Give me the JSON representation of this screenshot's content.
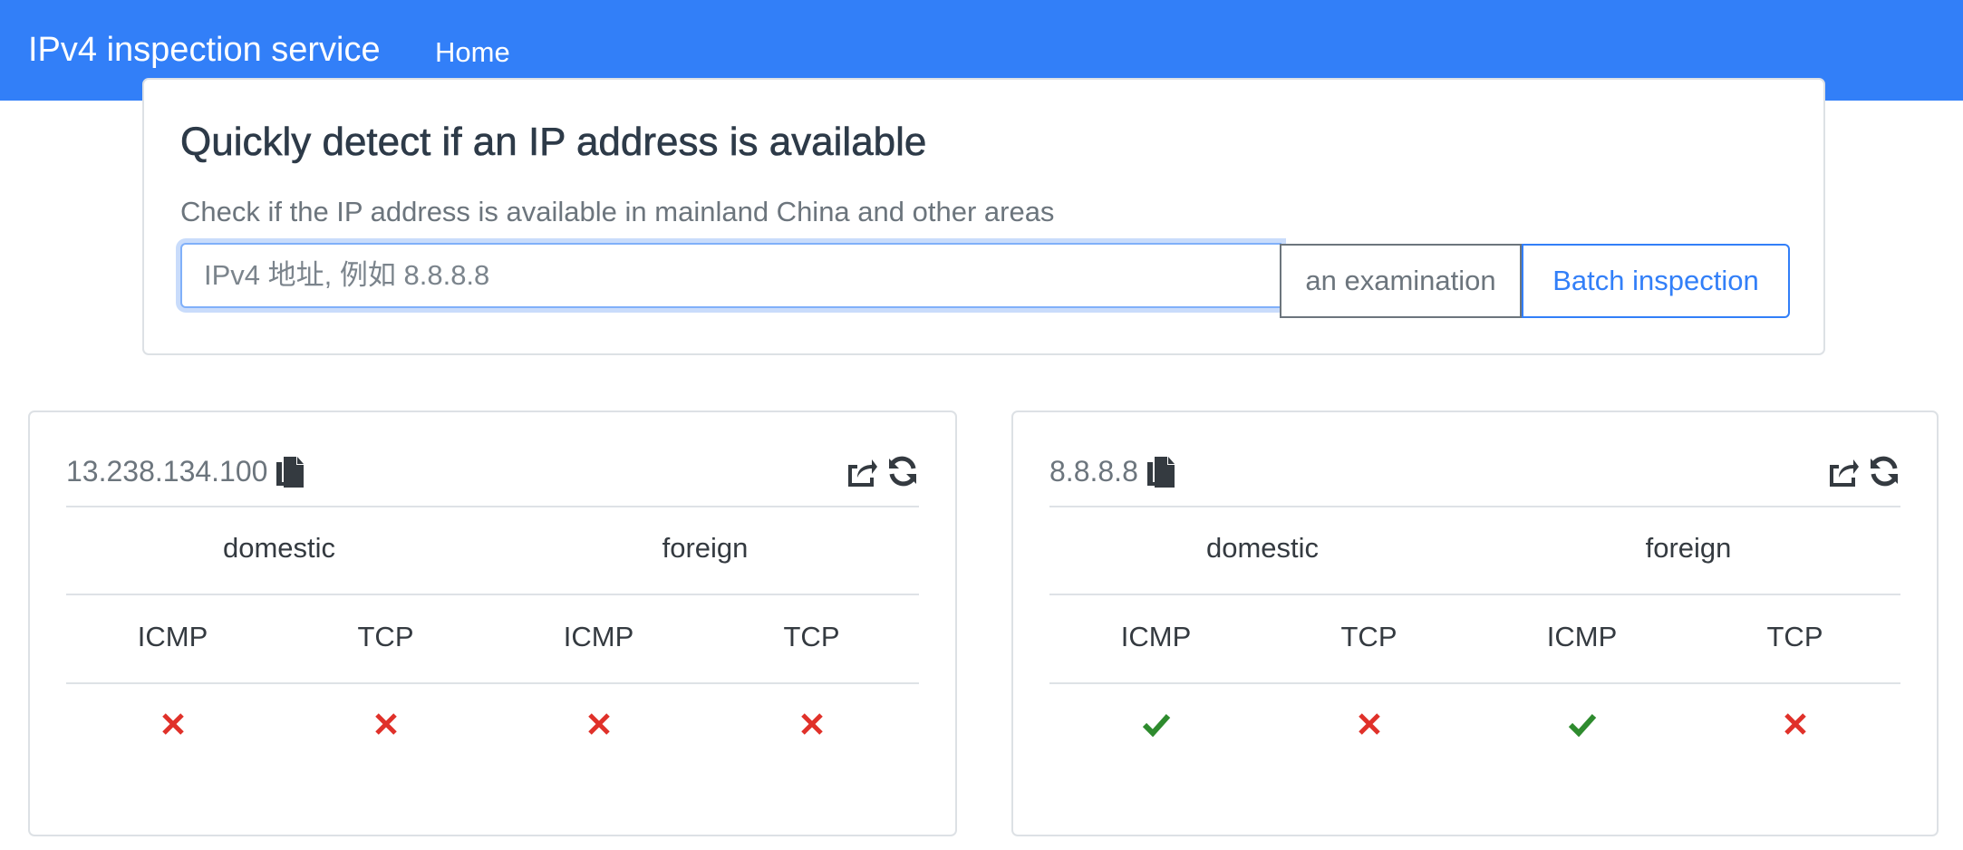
{
  "navbar": {
    "brand": "IPv4 inspection service",
    "home_label": "Home",
    "background": "#327ff8"
  },
  "hero": {
    "title": "Quickly detect if an IP address is available",
    "subtitle": "Check if the IP address is available in mainland China and other areas",
    "input_value": "",
    "input_placeholder": "IPv4 地址, 例如 8.8.8.8",
    "examine_label": "an examination",
    "batch_label": "Batch inspection"
  },
  "result_cards": [
    {
      "ip": "13.238.134.100",
      "copy_icon": "copy-icon",
      "share_icon": "share-icon",
      "refresh_icon": "refresh-icon",
      "groups": [
        "domestic",
        "foreign"
      ],
      "protocols": [
        "ICMP",
        "TCP",
        "ICMP",
        "TCP"
      ],
      "results": [
        "fail",
        "fail",
        "fail",
        "fail"
      ]
    },
    {
      "ip": "8.8.8.8",
      "copy_icon": "copy-icon",
      "share_icon": "share-icon",
      "refresh_icon": "refresh-icon",
      "groups": [
        "domestic",
        "foreign"
      ],
      "protocols": [
        "ICMP",
        "TCP",
        "ICMP",
        "TCP"
      ],
      "results": [
        "pass",
        "fail",
        "pass",
        "fail"
      ]
    }
  ],
  "colors": {
    "pass": "#2e8b2e",
    "fail": "#e0312a",
    "accent": "#327ff8"
  }
}
